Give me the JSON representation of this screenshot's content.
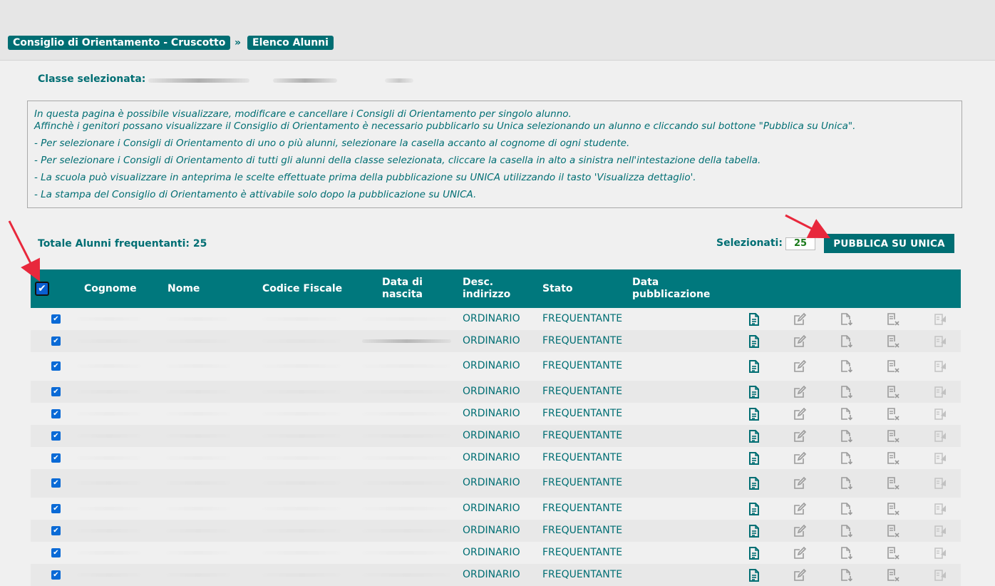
{
  "breadcrumb": {
    "item1": "Consiglio di Orientamento - Cruscotto",
    "separator": "»",
    "item2": "Elenco Alunni"
  },
  "classe_label": "Classe selezionata:",
  "info_lines": [
    "In questa pagina è possibile visualizzare, modificare e cancellare i Consigli di Orientamento per singolo alunno.",
    "Affinchè i genitori possano visualizzare il Consiglio di Orientamento è necessario pubblicarlo su Unica selezionando un alunno e cliccando sul bottone \"Pubblica su Unica\".",
    "- Per selezionare i Consigli di Orientamento di uno o più alunni, selezionare la casella accanto al cognome di ogni studente.",
    "- Per selezionare i Consigli di Orientamento di tutti gli alunni della classe selezionata, cliccare la casella in alto a sinistra nell'intestazione della tabella.",
    "- La scuola può visualizzare in anteprima le scelte effettuate prima della pubblicazione su UNICA utilizzando il tasto 'Visualizza dettaglio'.",
    "- La stampa del Consiglio di Orientamento è attivabile solo dopo la pubblicazione su UNICA."
  ],
  "totale_label": "Totale Alunni frequentanti: 25",
  "selezionati_label": "Selezionati:",
  "selezionati_count": "25",
  "pubblica_button": "PUBBLICA SU UNICA",
  "table": {
    "headers": {
      "cognome": "Cognome",
      "nome": "Nome",
      "codice_fiscale": "Codice Fiscale",
      "data_nascita": "Data di nascita",
      "desc_indirizzo": "Desc. indirizzo",
      "stato": "Stato",
      "data_pubblicazione": "Data pubblicazione"
    },
    "rows": [
      {
        "indirizzo": "ORDINARIO",
        "stato": "FREQUENTANTE"
      },
      {
        "indirizzo": "ORDINARIO",
        "stato": "FREQUENTANTE"
      },
      {
        "indirizzo": "ORDINARIO",
        "stato": "FREQUENTANTE"
      },
      {
        "indirizzo": "ORDINARIO",
        "stato": "FREQUENTANTE"
      },
      {
        "indirizzo": "ORDINARIO",
        "stato": "FREQUENTANTE"
      },
      {
        "indirizzo": "ORDINARIO",
        "stato": "FREQUENTANTE"
      },
      {
        "indirizzo": "ORDINARIO",
        "stato": "FREQUENTANTE"
      },
      {
        "indirizzo": "ORDINARIO",
        "stato": "FREQUENTANTE"
      },
      {
        "indirizzo": "ORDINARIO",
        "stato": "FREQUENTANTE"
      },
      {
        "indirizzo": "ORDINARIO",
        "stato": "FREQUENTANTE"
      },
      {
        "indirizzo": "ORDINARIO",
        "stato": "FREQUENTANTE"
      },
      {
        "indirizzo": "ORDINARIO",
        "stato": "FREQUENTANTE"
      }
    ],
    "row_icons": [
      "view-detail-icon",
      "edit-icon",
      "download-icon",
      "delete-icon",
      "print-icon"
    ]
  },
  "colors": {
    "accent": "#006e73",
    "header_bg": "#00787d",
    "checkbox": "#0a6ad6",
    "annotation_arrow": "#e8283c"
  }
}
